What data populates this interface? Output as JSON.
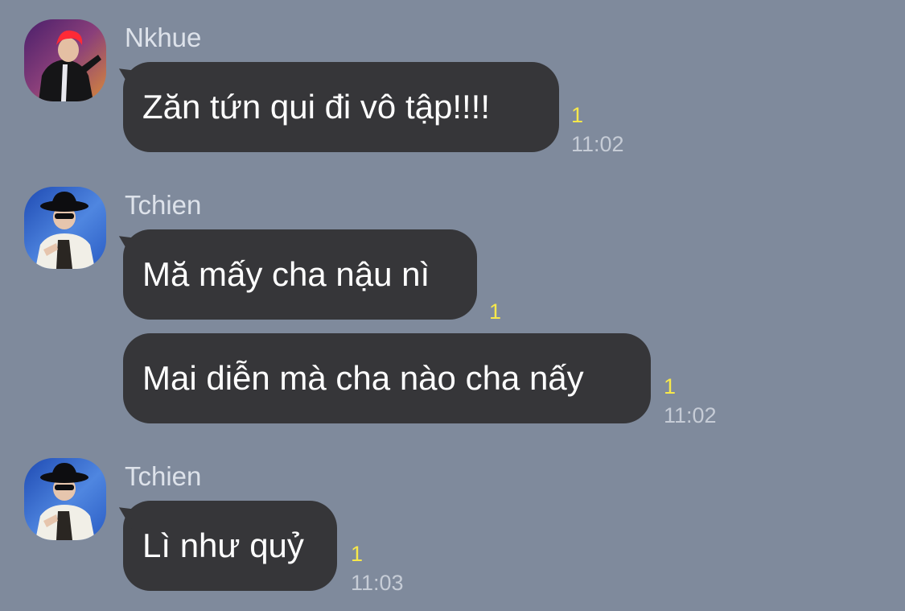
{
  "conversation": {
    "groups": [
      {
        "sender": "Nkhue",
        "avatar": "user-avatar-red-hair",
        "messages": [
          {
            "text": "Zăn tứn qui đi vô tập!!!!",
            "read_count": "1",
            "time": "11:02"
          }
        ]
      },
      {
        "sender": "Tchien",
        "avatar": "user-avatar-black-hat",
        "messages": [
          {
            "text": "Mă mấy cha nậu nì",
            "read_count": "1",
            "time": ""
          },
          {
            "text": "Mai diễn mà cha nào cha nấy",
            "read_count": "1",
            "time": "11:02"
          }
        ]
      },
      {
        "sender": "Tchien",
        "avatar": "user-avatar-black-hat",
        "messages": [
          {
            "text": "Lì như quỷ",
            "read_count": "1",
            "time": "11:03"
          }
        ]
      }
    ]
  },
  "colors": {
    "background": "#7f8a9c",
    "bubble": "#363639",
    "bubble_text": "#ffffff",
    "read_count": "#f7e84a",
    "timestamp": "#c6ccd6",
    "sender_name": "#dde2ea"
  }
}
